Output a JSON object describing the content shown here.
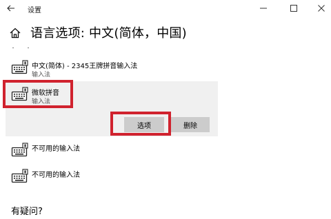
{
  "window": {
    "title": "设置",
    "back_icon": "back-arrow-icon",
    "min_icon": "minimize-icon",
    "max_icon": "maximize-icon",
    "close_icon": "close-icon"
  },
  "header": {
    "home_icon": "home-icon",
    "title": "语言选项: 中文(简体，中国)"
  },
  "keyboards": [
    {
      "name": "中文(简体) - 2345王牌拼音输入法",
      "type": "输入法",
      "icon": "keyboard-icon"
    },
    {
      "name": "微软拼音",
      "type": "输入法",
      "icon": "keyboard-icon",
      "selected": true
    },
    {
      "name": "不可用的输入法",
      "icon": "keyboard-icon"
    },
    {
      "name": "不可用的输入法",
      "icon": "keyboard-icon"
    }
  ],
  "actions": {
    "options_label": "选项",
    "delete_label": "删除"
  },
  "help": {
    "heading": "有疑问?"
  },
  "colors": {
    "highlight": "#d0222e",
    "selected_bg": "#f0f0f0",
    "button_bg": "#cccccc"
  }
}
